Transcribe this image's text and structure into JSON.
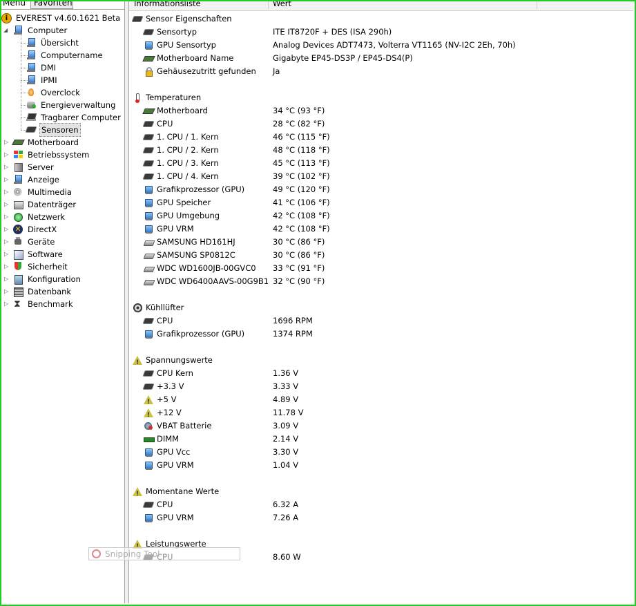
{
  "tabs": [
    "Menü",
    "Favoriten"
  ],
  "tree": {
    "root": "EVEREST v4.60.1621 Beta",
    "computer": "Computer",
    "computer_children": [
      "Übersicht",
      "Computername",
      "DMI",
      "IPMI",
      "Overclock",
      "Energieverwaltung",
      "Tragbarer Computer",
      "Sensoren"
    ],
    "categories": [
      "Motherboard",
      "Betriebssystem",
      "Server",
      "Anzeige",
      "Multimedia",
      "Datenträger",
      "Netzwerk",
      "DirectX",
      "Geräte",
      "Software",
      "Sicherheit",
      "Konfiguration",
      "Datenbank",
      "Benchmark"
    ]
  },
  "columns": [
    "Informationsliste",
    "Wert"
  ],
  "sections": [
    {
      "title": "Sensor Eigenschaften",
      "icon": "chip-icon",
      "rows": [
        {
          "label": "Sensortyp",
          "value": "ITE IT8720F + DES  (ISA 290h)",
          "icon": "chip"
        },
        {
          "label": "GPU Sensortyp",
          "value": "Analog Devices ADT7473, Volterra VT1165  (NV-I2C 2Eh, 70h)",
          "icon": "mon"
        },
        {
          "label": "Motherboard Name",
          "value": "Gigabyte EP45-DS3P / EP45-DS4(P)",
          "icon": "mb"
        },
        {
          "label": "Gehäusezutritt gefunden",
          "value": "Ja",
          "icon": "lock"
        }
      ]
    },
    {
      "title": "Temperaturen",
      "icon": "thermometer-icon",
      "rows": [
        {
          "label": "Motherboard",
          "value": "34 °C  (93 °F)",
          "icon": "mb"
        },
        {
          "label": "CPU",
          "value": "28 °C  (82 °F)",
          "icon": "chip"
        },
        {
          "label": "1. CPU / 1. Kern",
          "value": "46 °C  (115 °F)",
          "icon": "chip"
        },
        {
          "label": "1. CPU / 2. Kern",
          "value": "48 °C  (118 °F)",
          "icon": "chip"
        },
        {
          "label": "1. CPU / 3. Kern",
          "value": "45 °C  (113 °F)",
          "icon": "chip"
        },
        {
          "label": "1. CPU / 4. Kern",
          "value": "39 °C  (102 °F)",
          "icon": "chip"
        },
        {
          "label": "Grafikprozessor (GPU)",
          "value": "49 °C  (120 °F)",
          "icon": "mon"
        },
        {
          "label": "GPU Speicher",
          "value": "41 °C  (106 °F)",
          "icon": "mon"
        },
        {
          "label": "GPU Umgebung",
          "value": "42 °C  (108 °F)",
          "icon": "mon"
        },
        {
          "label": "GPU VRM",
          "value": "42 °C  (108 °F)",
          "icon": "mon"
        },
        {
          "label": "SAMSUNG HD161HJ",
          "value": "30 °C  (86 °F)",
          "icon": "disk"
        },
        {
          "label": "SAMSUNG SP0812C",
          "value": "30 °C  (86 °F)",
          "icon": "disk"
        },
        {
          "label": "WDC WD1600JB-00GVC0",
          "value": "33 °C  (91 °F)",
          "icon": "disk"
        },
        {
          "label": "WDC WD6400AAVS-00G9B1",
          "value": "32 °C  (90 °F)",
          "icon": "disk"
        }
      ]
    },
    {
      "title": "Kühllüfter",
      "icon": "fan-icon",
      "rows": [
        {
          "label": "CPU",
          "value": "1696 RPM",
          "icon": "chip"
        },
        {
          "label": "Grafikprozessor (GPU)",
          "value": "1374 RPM",
          "icon": "mon"
        }
      ]
    },
    {
      "title": "Spannungswerte",
      "icon": "warning-icon",
      "rows": [
        {
          "label": "CPU Kern",
          "value": "1.36 V",
          "icon": "chip"
        },
        {
          "label": "+3.3 V",
          "value": "3.33 V",
          "icon": "chip"
        },
        {
          "label": "+5 V",
          "value": "4.89 V",
          "icon": "warn"
        },
        {
          "label": "+12 V",
          "value": "11.78 V",
          "icon": "warn"
        },
        {
          "label": "VBAT Batterie",
          "value": "3.09 V",
          "icon": "vbat"
        },
        {
          "label": "DIMM",
          "value": "2.14 V",
          "icon": "ram"
        },
        {
          "label": "GPU Vcc",
          "value": "3.30 V",
          "icon": "mon"
        },
        {
          "label": "GPU VRM",
          "value": "1.04 V",
          "icon": "mon"
        }
      ]
    },
    {
      "title": "Momentane Werte",
      "icon": "warning-icon",
      "rows": [
        {
          "label": "CPU",
          "value": "6.32 A",
          "icon": "chip"
        },
        {
          "label": "GPU VRM",
          "value": "7.26 A",
          "icon": "mon"
        }
      ]
    },
    {
      "title": "Leistungswerte",
      "icon": "warning-icon",
      "rows": [
        {
          "label": "CPU",
          "value": "8.60 W",
          "icon": "chip"
        }
      ]
    }
  ],
  "snipping": "Snipping Tool",
  "colors": {
    "frame": "#22cc22",
    "selection": "#e4e4e4"
  }
}
